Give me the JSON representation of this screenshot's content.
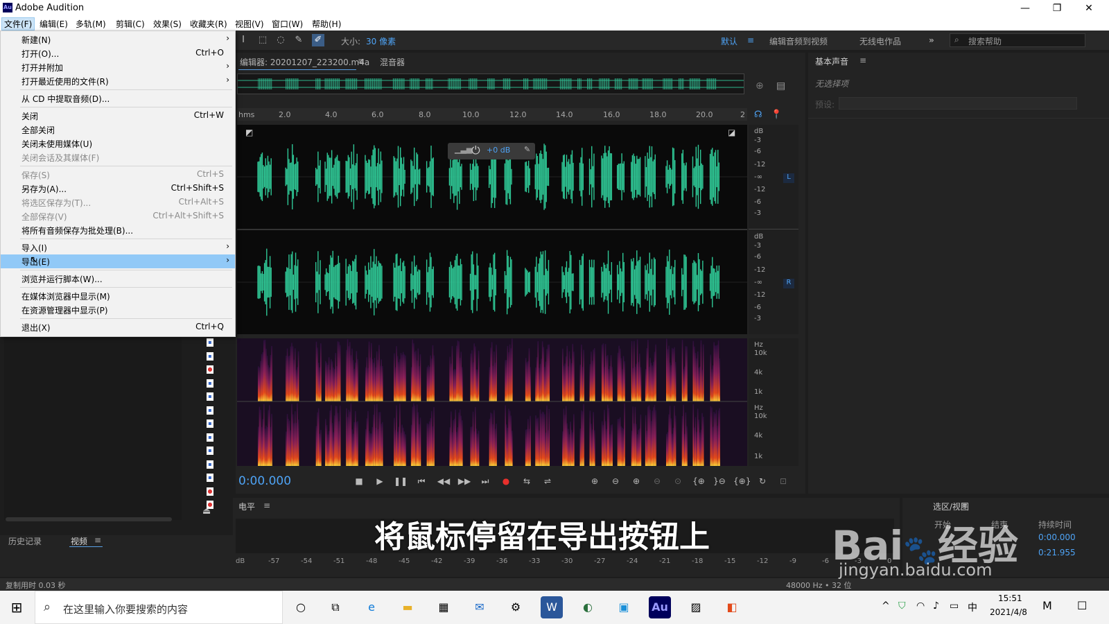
{
  "app": {
    "title": "Adobe Audition",
    "logo_text": "Au"
  },
  "window_controls": {
    "minimize": "—",
    "restore": "❐",
    "close": "✕"
  },
  "menubar": [
    "文件(F)",
    "编辑(E)",
    "多轨(M)",
    "剪辑(C)",
    "效果(S)",
    "收藏夹(R)",
    "视图(V)",
    "窗口(W)",
    "帮助(H)"
  ],
  "toolbar": {
    "size_label": "大小:",
    "size_value": "30 像素",
    "workspaces": [
      "默认",
      "编辑音频到视频",
      "无线电作品"
    ],
    "search_placeholder": "搜索帮助"
  },
  "editor": {
    "tab_editor": "编辑器: 20201207_223200.m4a",
    "tab_mixer": "混音器",
    "ruler_unit": "hms",
    "ruler_ticks": [
      "2.0",
      "4.0",
      "6.0",
      "8.0",
      "10.0",
      "12.0",
      "14.0",
      "16.0",
      "18.0",
      "20.0",
      "2"
    ],
    "hud_value": "+0 dB",
    "db_labels_top": [
      "dB",
      "-3",
      "-6",
      "-12",
      "-∞",
      "-12",
      "-6",
      "-3"
    ],
    "db_labels_bottom": [
      "dB",
      "-3",
      "-6",
      "-12",
      "-∞",
      "-12",
      "-6",
      "-3"
    ],
    "channel_left": "L",
    "channel_right": "R",
    "hz_labels_top": [
      "Hz",
      "10k",
      "4k",
      "1k"
    ],
    "hz_labels_bottom": [
      "Hz",
      "10k",
      "4k",
      "1k"
    ],
    "time_display": "0:00.000"
  },
  "right_panel": {
    "title": "基本声音",
    "no_selection": "无选择项",
    "preset_label": "预设:"
  },
  "levels": {
    "title": "电平",
    "scale": [
      "dB",
      "-57",
      "-54",
      "-51",
      "-48",
      "-45",
      "-42",
      "-39",
      "-36",
      "-33",
      "-30",
      "-27",
      "-24",
      "-21",
      "-18",
      "-15",
      "-12",
      "-9",
      "-6",
      "-3",
      "0"
    ]
  },
  "selection_view": {
    "title": "选区/视图",
    "col_start": "开始",
    "col_end": "结束",
    "col_duration": "持续时间",
    "row1_duration": "0:00.000",
    "row2_duration": "0:21.955"
  },
  "history": {
    "tab_history": "历史记录",
    "tab_video": "视频"
  },
  "status": {
    "left": "复制用时 0.03 秒",
    "right": "48000 Hz • 32 位"
  },
  "file_menu": [
    {
      "label": "新建(N)",
      "shortcut": "",
      "submenu": true,
      "disabled": false
    },
    {
      "label": "打开(O)...",
      "shortcut": "Ctrl+O",
      "submenu": false,
      "disabled": false
    },
    {
      "label": "打开并附加",
      "shortcut": "",
      "submenu": true,
      "disabled": false
    },
    {
      "label": "打开最近使用的文件(R)",
      "shortcut": "",
      "submenu": true,
      "disabled": false
    },
    {
      "label": "从 CD 中提取音频(D)...",
      "shortcut": "",
      "submenu": false,
      "disabled": false
    },
    {
      "label": "关闭",
      "shortcut": "Ctrl+W",
      "submenu": false,
      "disabled": false
    },
    {
      "label": "全部关闭",
      "shortcut": "",
      "submenu": false,
      "disabled": false
    },
    {
      "label": "关闭未使用媒体(U)",
      "shortcut": "",
      "submenu": false,
      "disabled": false
    },
    {
      "label": "关闭会话及其媒体(F)",
      "shortcut": "",
      "submenu": false,
      "disabled": true
    },
    {
      "label": "保存(S)",
      "shortcut": "Ctrl+S",
      "submenu": false,
      "disabled": true
    },
    {
      "label": "另存为(A)...",
      "shortcut": "Ctrl+Shift+S",
      "submenu": false,
      "disabled": false
    },
    {
      "label": "将选区保存为(T)...",
      "shortcut": "Ctrl+Alt+S",
      "submenu": false,
      "disabled": true
    },
    {
      "label": "全部保存(V)",
      "shortcut": "Ctrl+Alt+Shift+S",
      "submenu": false,
      "disabled": true
    },
    {
      "label": "将所有音频保存为批处理(B)...",
      "shortcut": "",
      "submenu": false,
      "disabled": false
    },
    {
      "label": "导入(I)",
      "shortcut": "",
      "submenu": true,
      "disabled": false
    },
    {
      "label": "导出(E)",
      "shortcut": "",
      "submenu": true,
      "disabled": false,
      "highlighted": true
    },
    {
      "label": "浏览并运行脚本(W)...",
      "shortcut": "",
      "submenu": false,
      "disabled": false
    },
    {
      "label": "在媒体浏览器中显示(M)",
      "shortcut": "",
      "submenu": false,
      "disabled": false
    },
    {
      "label": "在资源管理器中显示(P)",
      "shortcut": "",
      "submenu": false,
      "disabled": false
    },
    {
      "label": "退出(X)",
      "shortcut": "Ctrl+Q",
      "submenu": false,
      "disabled": false
    }
  ],
  "caption": "将鼠标停留在导出按钮上",
  "watermark": {
    "brand": "Bai",
    "suffix": "经验",
    "url": "jingyan.baidu.com"
  },
  "taskbar": {
    "search_placeholder": "在这里输入你要搜索的内容",
    "clock_time": "15:51",
    "clock_date": "2021/4/8",
    "ime": "中"
  }
}
